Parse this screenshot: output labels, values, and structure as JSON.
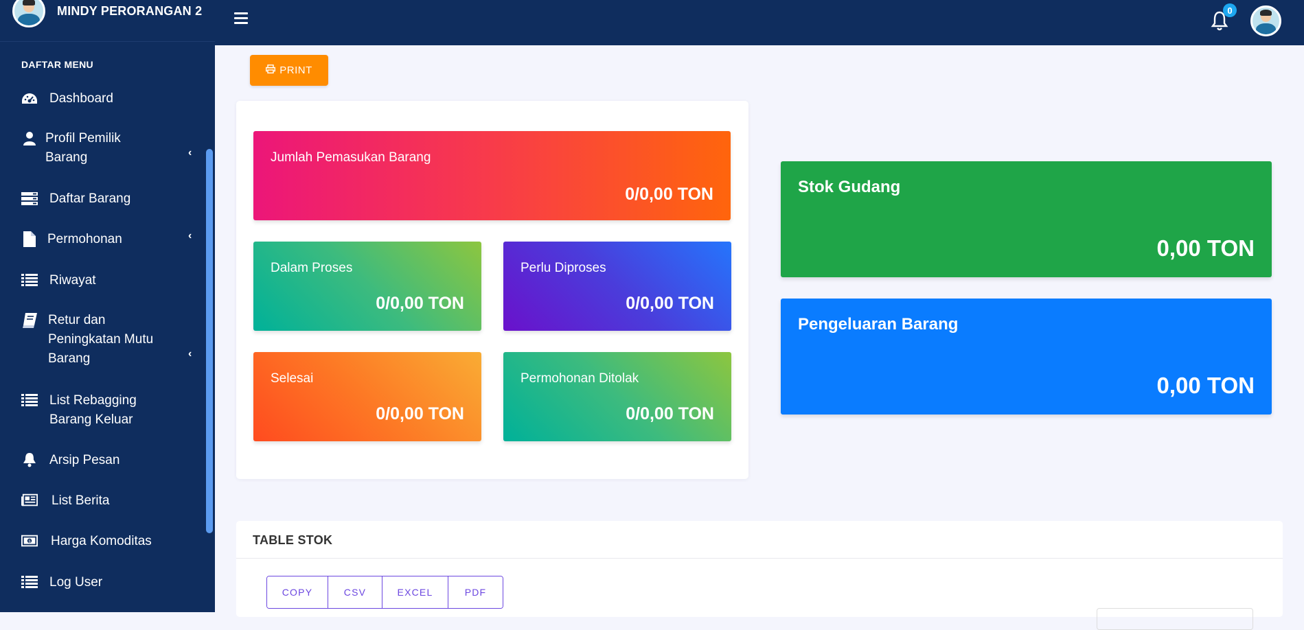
{
  "brand": {
    "name": "MINDY PERORANGAN 2"
  },
  "sidebar": {
    "header": "DAFTAR MENU",
    "items": [
      {
        "label": "Dashboard",
        "icon": "dashboard-icon"
      },
      {
        "label": "Profil Pemilik\n Barang",
        "icon": "user-icon",
        "submenu": true
      },
      {
        "label": "Daftar Barang",
        "icon": "server-icon"
      },
      {
        "label": "Permohonan",
        "icon": "file-icon",
        "submenu": true
      },
      {
        "label": "Riwayat",
        "icon": "list-icon"
      },
      {
        "label": "Retur dan\n Peningkatan Mutu\n Barang",
        "icon": "book-icon",
        "submenu": true
      },
      {
        "label": "List Rebagging\n Barang Keluar",
        "icon": "list-icon"
      },
      {
        "label": "Arsip Pesan",
        "icon": "bell-icon"
      },
      {
        "label": "List Berita",
        "icon": "newspaper-icon"
      },
      {
        "label": "Harga Komoditas",
        "icon": "money-icon"
      },
      {
        "label": "Log User",
        "icon": "list-icon"
      }
    ]
  },
  "topbar": {
    "notification_count": "0"
  },
  "toolbar": {
    "print_label": "PRINT"
  },
  "cards": {
    "pemasukan": {
      "title": "Jumlah Pemasukan Barang",
      "value": "0/0,00 TON"
    },
    "dalam_proses": {
      "title": "Dalam Proses",
      "value": "0/0,00 TON"
    },
    "perlu_diproses": {
      "title": "Perlu Diproses",
      "value": "0/0,00 TON"
    },
    "selesai": {
      "title": "Selesai",
      "value": "0/0,00 TON"
    },
    "ditolak": {
      "title": "Permohonan Ditolak",
      "value": "0/0,00 TON"
    },
    "stok_gudang": {
      "title": "Stok Gudang",
      "value": "0,00 TON"
    },
    "pengeluaran": {
      "title": "Pengeluaran Barang",
      "value": "0,00 TON"
    }
  },
  "table": {
    "title": "TABLE STOK",
    "buttons": [
      "COPY",
      "CSV",
      "EXCEL",
      "PDF"
    ]
  },
  "colors": {
    "sidebar": "#0f2d5e",
    "print": "#ff8c00",
    "stok_gudang": "#1fa548",
    "pengeluaran": "#0a7cff"
  }
}
